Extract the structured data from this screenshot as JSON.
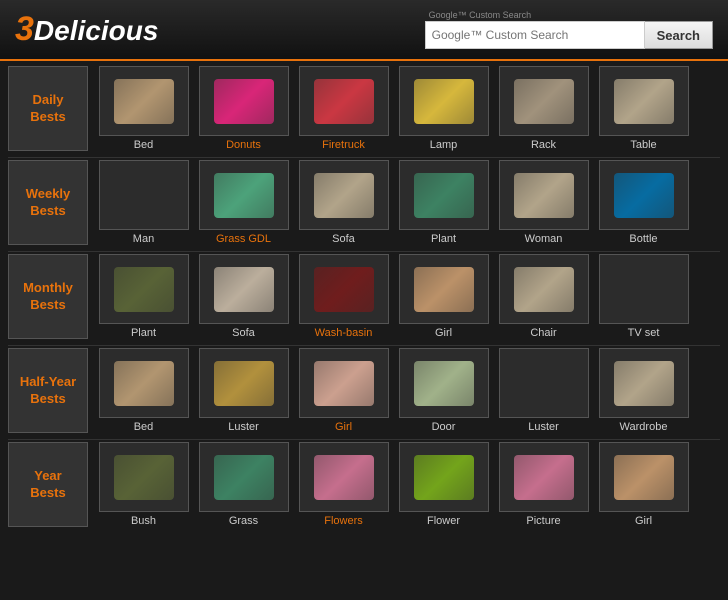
{
  "header": {
    "logo_3": "3",
    "logo_text": "Delicious",
    "search_placeholder": "Google™ Custom Search",
    "search_label": "Search",
    "google_label": "Google™ Custom Search"
  },
  "sections": [
    {
      "id": "daily",
      "label": "Daily\nBests",
      "items": [
        {
          "name": "Bed",
          "color": "bed",
          "label_orange": false
        },
        {
          "name": "Donuts",
          "color": "donuts",
          "label_orange": true
        },
        {
          "name": "Firetruck",
          "color": "firetruck",
          "label_orange": true
        },
        {
          "name": "Lamp",
          "color": "lamp",
          "label_orange": false
        },
        {
          "name": "Rack",
          "color": "rack",
          "label_orange": false
        },
        {
          "name": "Table",
          "color": "table",
          "label_orange": false
        }
      ]
    },
    {
      "id": "weekly",
      "label": "Weekly\nBests",
      "items": [
        {
          "name": "Man",
          "color": "man",
          "label_orange": false
        },
        {
          "name": "Grass GDL",
          "color": "grass",
          "label_orange": true
        },
        {
          "name": "Sofa",
          "color": "sofa",
          "label_orange": false
        },
        {
          "name": "Plant",
          "color": "plant",
          "label_orange": false
        },
        {
          "name": "Woman",
          "color": "woman",
          "label_orange": false
        },
        {
          "name": "Bottle",
          "color": "bottle",
          "label_orange": false
        }
      ]
    },
    {
      "id": "monthly",
      "label": "Monthly\nBests",
      "items": [
        {
          "name": "Plant",
          "color": "plant2",
          "label_orange": false
        },
        {
          "name": "Sofa",
          "color": "sofa2",
          "label_orange": false
        },
        {
          "name": "Wash-basin",
          "color": "washbasin",
          "label_orange": true
        },
        {
          "name": "Girl",
          "color": "girl",
          "label_orange": false
        },
        {
          "name": "Chair",
          "color": "chair",
          "label_orange": false
        },
        {
          "name": "TV set",
          "color": "tvset",
          "label_orange": false
        }
      ]
    },
    {
      "id": "halfyear",
      "label": "Half-Year\nBests",
      "items": [
        {
          "name": "Bed",
          "color": "bed2",
          "label_orange": false
        },
        {
          "name": "Luster",
          "color": "luster",
          "label_orange": false
        },
        {
          "name": "Girl",
          "color": "girl2",
          "label_orange": true
        },
        {
          "name": "Door",
          "color": "door",
          "label_orange": false
        },
        {
          "name": "Luster",
          "color": "luster2",
          "label_orange": false
        },
        {
          "name": "Wardrobe",
          "color": "wardrobe",
          "label_orange": false
        }
      ]
    },
    {
      "id": "year",
      "label": "Year\nBests",
      "items": [
        {
          "name": "Bush",
          "color": "bush",
          "label_orange": false
        },
        {
          "name": "Grass",
          "color": "grass2",
          "label_orange": false
        },
        {
          "name": "Flowers",
          "color": "flowers",
          "label_orange": true
        },
        {
          "name": "Flower",
          "color": "flower",
          "label_orange": false
        },
        {
          "name": "Picture",
          "color": "picture",
          "label_orange": false
        },
        {
          "name": "Girl",
          "color": "girl3",
          "label_orange": false
        }
      ]
    }
  ]
}
